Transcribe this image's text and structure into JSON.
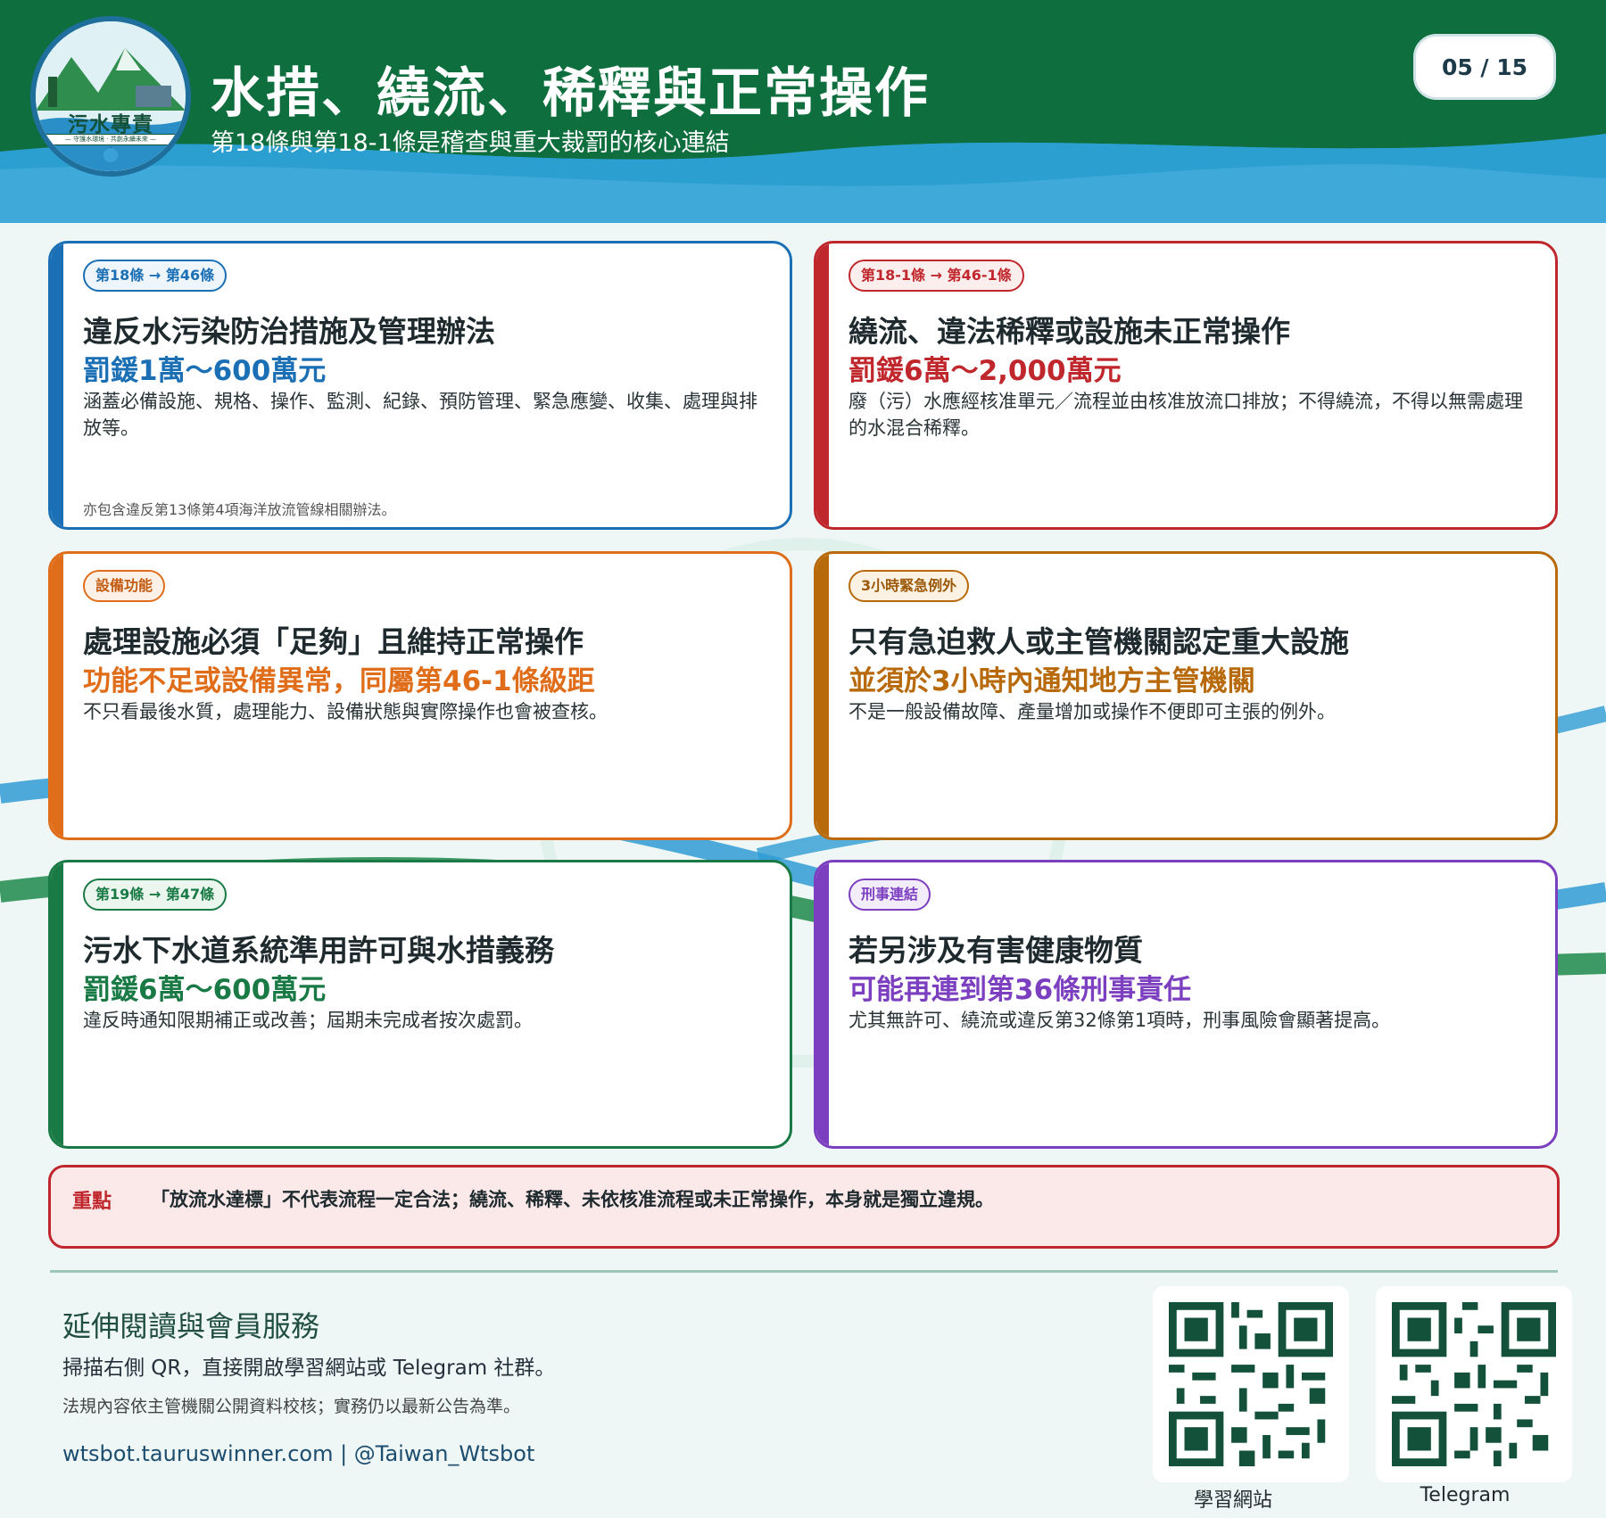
{
  "logo": {
    "text": "污水專責",
    "tagline": "— 守護水環境 · 共創永續未來 —"
  },
  "header": {
    "title": "水措、繞流、稀釋與正常操作",
    "subtitle": "第18條與第18-1條是稽查與重大裁罰的核心連結",
    "page": "05 / 15"
  },
  "cards": [
    {
      "tag": "第18條 → 第46條",
      "heading": "違反水污染防治措施及管理辦法",
      "penalty": "罰鍰1萬～600萬元",
      "desc": "涵蓋必備設施、規格、操作、監測、紀錄、預防管理、緊急應變、收集、處理與排放等。",
      "note": "亦包含違反第13條第4項海洋放流管線相關辦法。",
      "color": "#1b6fb4"
    },
    {
      "tag": "第18-1條 → 第46-1條",
      "heading": "繞流、違法稀釋或設施未正常操作",
      "penalty": "罰鍰6萬～2,000萬元",
      "desc": "廢（污）水應經核准單元／流程並由核准放流口排放；不得繞流，不得以無需處理的水混合稀釋。",
      "note": "",
      "color": "#c0272d"
    },
    {
      "tag": "設備功能",
      "heading": "處理設施必須「足夠」且維持正常操作",
      "penalty": "功能不足或設備異常，同屬第46-1條級距",
      "desc": "不只看最後水質，處理能力、設備狀態與實際操作也會被查核。",
      "note": "",
      "color": "#e06d1a"
    },
    {
      "tag": "3小時緊急例外",
      "heading": "只有急迫救人或主管機關認定重大設施",
      "penalty": "並須於3小時內通知地方主管機關",
      "desc": "不是一般設備故障、產量增加或操作不便即可主張的例外。",
      "note": "",
      "color": "#b86a0a"
    },
    {
      "tag": "第19條 → 第47條",
      "heading": "污水下水道系統準用許可與水措義務",
      "penalty": "罰鍰6萬～600萬元",
      "desc": "違反時通知限期補正或改善；屆期未完成者按次處罰。",
      "note": "",
      "color": "#1a7a45"
    },
    {
      "tag": "刑事連結",
      "heading": "若另涉及有害健康物質",
      "penalty": "可能再連到第36條刑事責任",
      "desc": "尤其無許可、繞流或違反第32條第1項時，刑事風險會顯著提高。",
      "note": "",
      "color": "#7b3fbf"
    }
  ],
  "callout": {
    "key": "重點",
    "text": "「放流水達標」不代表流程一定合法；繞流、稀釋、未依核准流程或未正常操作，本身就是獨立違規。"
  },
  "footer": {
    "title": "延伸閱讀與會員服務",
    "line1": "掃描右側 QR，直接開啟學習網站或 Telegram 社群。",
    "line2": "法規內容依主管機關公開資料校核；實務仍以最新公告為準。",
    "links": "wtsbot.tauruswinner.com   |   @Taiwan_Wtsbot",
    "qr_labels": [
      "學習網站",
      "Telegram"
    ]
  }
}
